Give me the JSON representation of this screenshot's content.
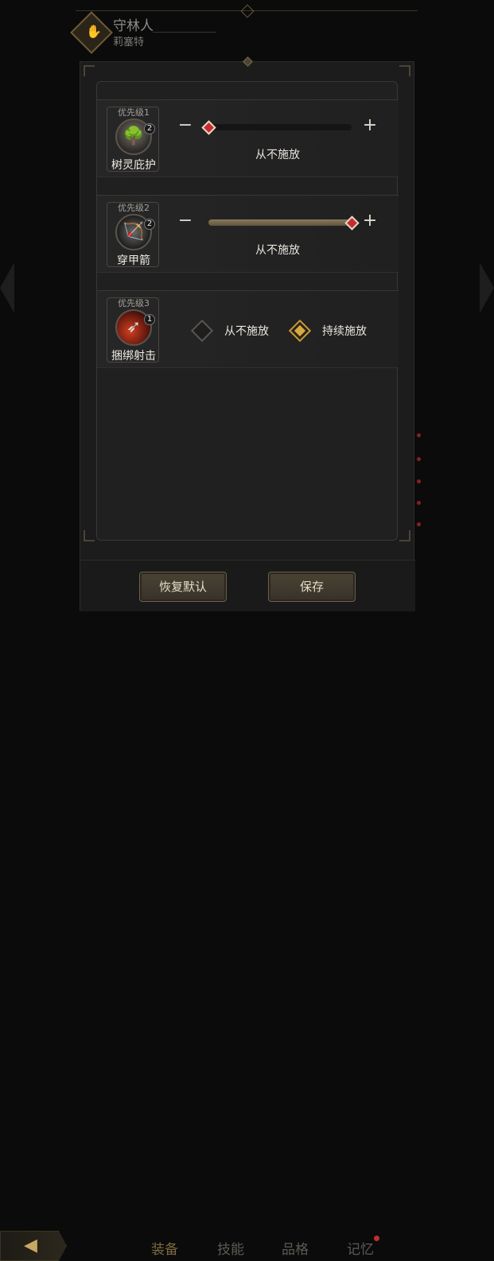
{
  "header": {
    "title": "守林人",
    "subtitle": "莉塞特"
  },
  "bottom_tabs": [
    {
      "label": "装备",
      "active": true
    },
    {
      "label": "技能",
      "active": false
    },
    {
      "label": "品格",
      "active": false
    },
    {
      "label": "记忆",
      "active": false,
      "has_notification": true
    }
  ],
  "skills": [
    {
      "priority": "优先级1",
      "name": "树灵庇护",
      "badge": "2",
      "icon": "tree-icon",
      "control": "slider",
      "slider_fraction": 0.0,
      "value_label": "从不施放"
    },
    {
      "priority": "优先级2",
      "name": "穿甲箭",
      "badge": "2",
      "icon": "archer-icon",
      "control": "slider",
      "slider_fraction": 1.0,
      "value_label": "从不施放"
    },
    {
      "priority": "优先级3",
      "name": "捆绑射击",
      "badge": "1",
      "icon": "bind-shot-icon",
      "control": "toggle",
      "option_never": "从不施放",
      "option_always": "持续施放",
      "selected": "always"
    }
  ],
  "buttons": {
    "reset": "恢复默认",
    "save": "保存"
  },
  "colors": {
    "accent_gold": "#c79a3a",
    "slider_thumb": "#c72c2c"
  }
}
